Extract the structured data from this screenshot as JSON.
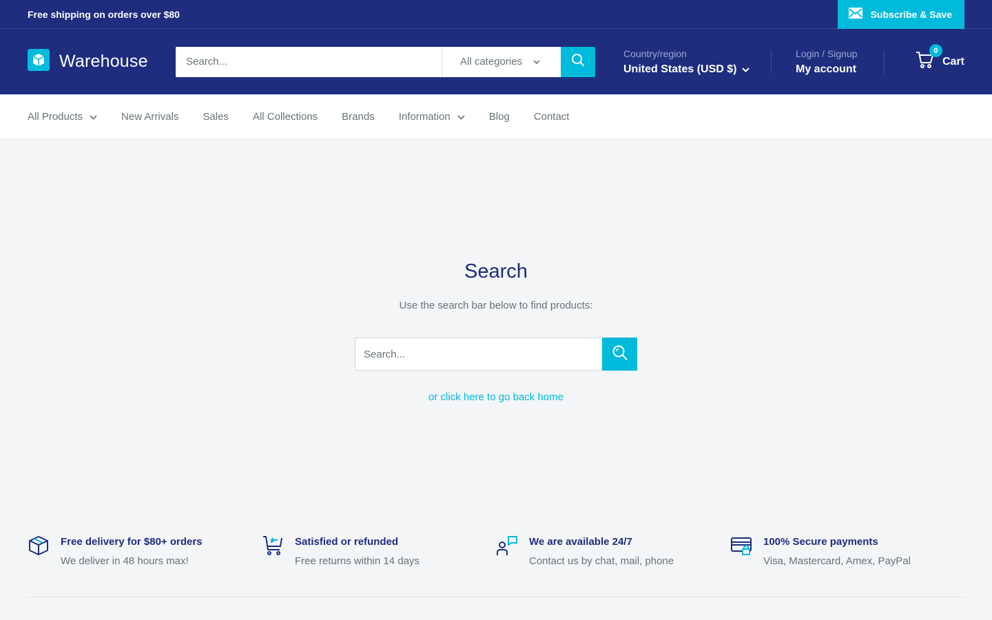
{
  "announcement": {
    "text": "Free shipping on orders over $80",
    "subscribe_label": "Subscribe & Save"
  },
  "header": {
    "logo_text": "Warehouse",
    "search_placeholder": "Search...",
    "category_label": "All categories",
    "region_label": "Country/region",
    "region_value": "United States (USD $)",
    "login_label": "Login / Signup",
    "account_label": "My account",
    "cart_count": "0",
    "cart_label": "Cart"
  },
  "nav": {
    "items": [
      {
        "label": "All Products",
        "dropdown": true
      },
      {
        "label": "New Arrivals",
        "dropdown": false
      },
      {
        "label": "Sales",
        "dropdown": false
      },
      {
        "label": "All Collections",
        "dropdown": false
      },
      {
        "label": "Brands",
        "dropdown": false
      },
      {
        "label": "Information",
        "dropdown": true
      },
      {
        "label": "Blog",
        "dropdown": false
      },
      {
        "label": "Contact",
        "dropdown": false
      }
    ]
  },
  "main": {
    "title": "Search",
    "description": "Use the search bar below to find products:",
    "search_placeholder": "Search...",
    "home_link": "or click here to go back home"
  },
  "features": [
    {
      "icon": "box-icon",
      "title": "Free delivery for $80+ orders",
      "subtitle": "We deliver in 48 hours max!"
    },
    {
      "icon": "cart-return-icon",
      "title": "Satisfied or refunded",
      "subtitle": "Free returns within 14 days"
    },
    {
      "icon": "support-chat-icon",
      "title": "We are available 24/7",
      "subtitle": "Contact us by chat, mail, phone"
    },
    {
      "icon": "secure-card-icon",
      "title": "100% Secure payments",
      "subtitle": "Visa, Mastercard, Amex, PayPal"
    }
  ],
  "colors": {
    "primary": "#1e2d7d",
    "accent": "#00badb",
    "background": "#f3f5f6",
    "text": "#677279"
  }
}
